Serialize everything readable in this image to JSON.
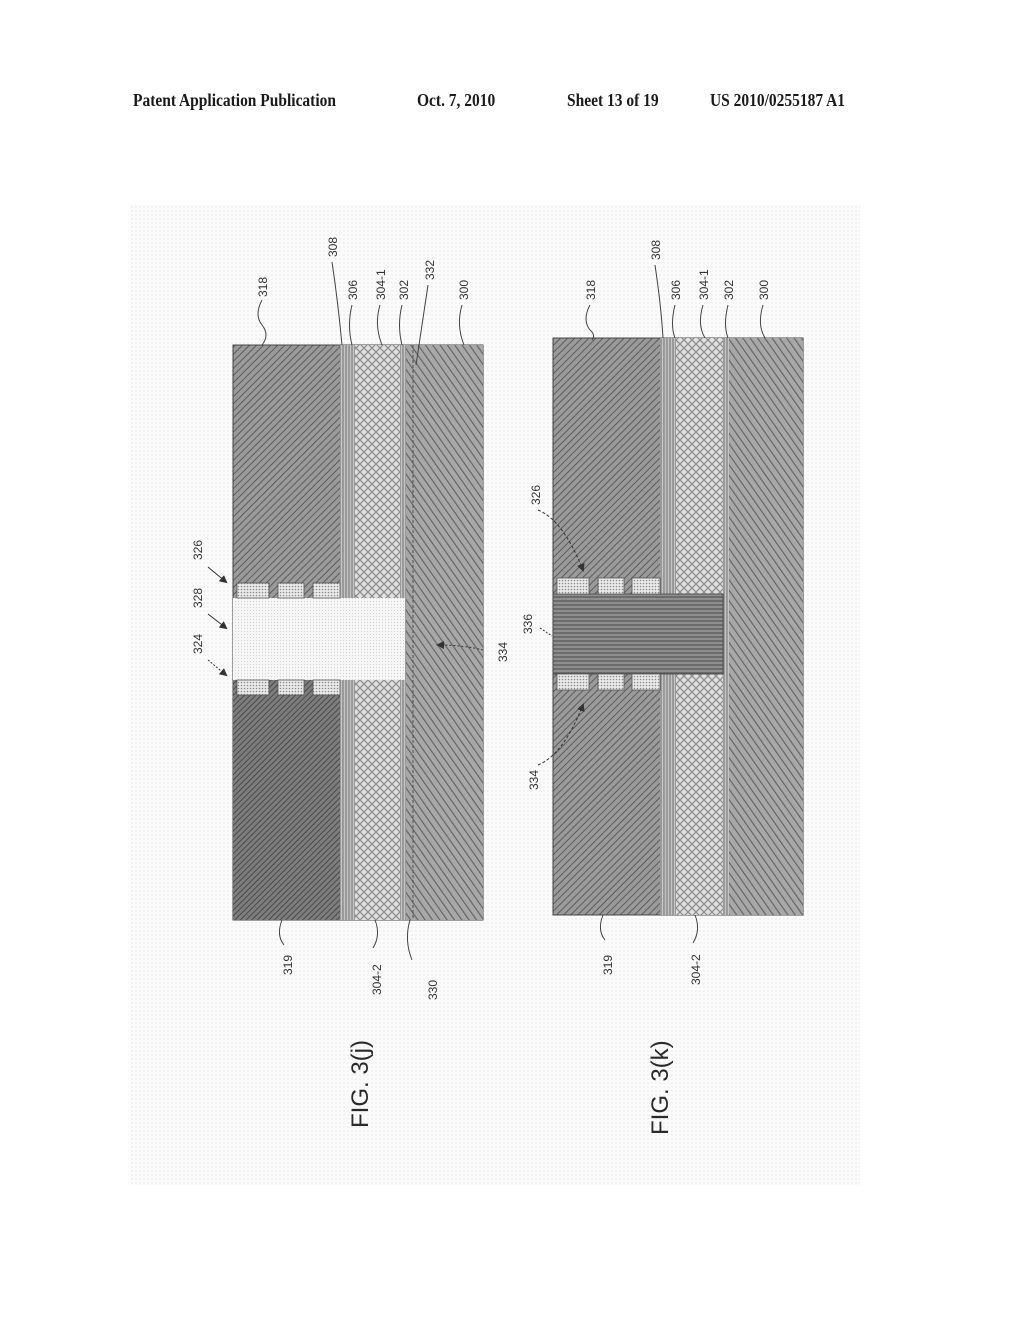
{
  "header": {
    "publication": "Patent Application Publication",
    "date": "Oct. 7, 2010",
    "sheet": "Sheet 13 of 19",
    "number": "US 2010/0255187 A1"
  },
  "figures": [
    {
      "id": "fig-3j",
      "caption": "FIG. 3(j)",
      "labels_top": [
        "318",
        "308",
        "306",
        "304-1",
        "302",
        "332",
        "300"
      ],
      "labels_bottom": [
        "319",
        "304-2",
        "330"
      ],
      "labels_side": [
        "326",
        "328",
        "324"
      ],
      "label_inner": "334"
    },
    {
      "id": "fig-3k",
      "caption": "FIG. 3(k)",
      "labels_top": [
        "318",
        "308",
        "306",
        "304-1",
        "302",
        "300"
      ],
      "labels_bottom": [
        "319",
        "304-2"
      ],
      "labels_side": [
        "326",
        "336",
        "334"
      ]
    }
  ]
}
